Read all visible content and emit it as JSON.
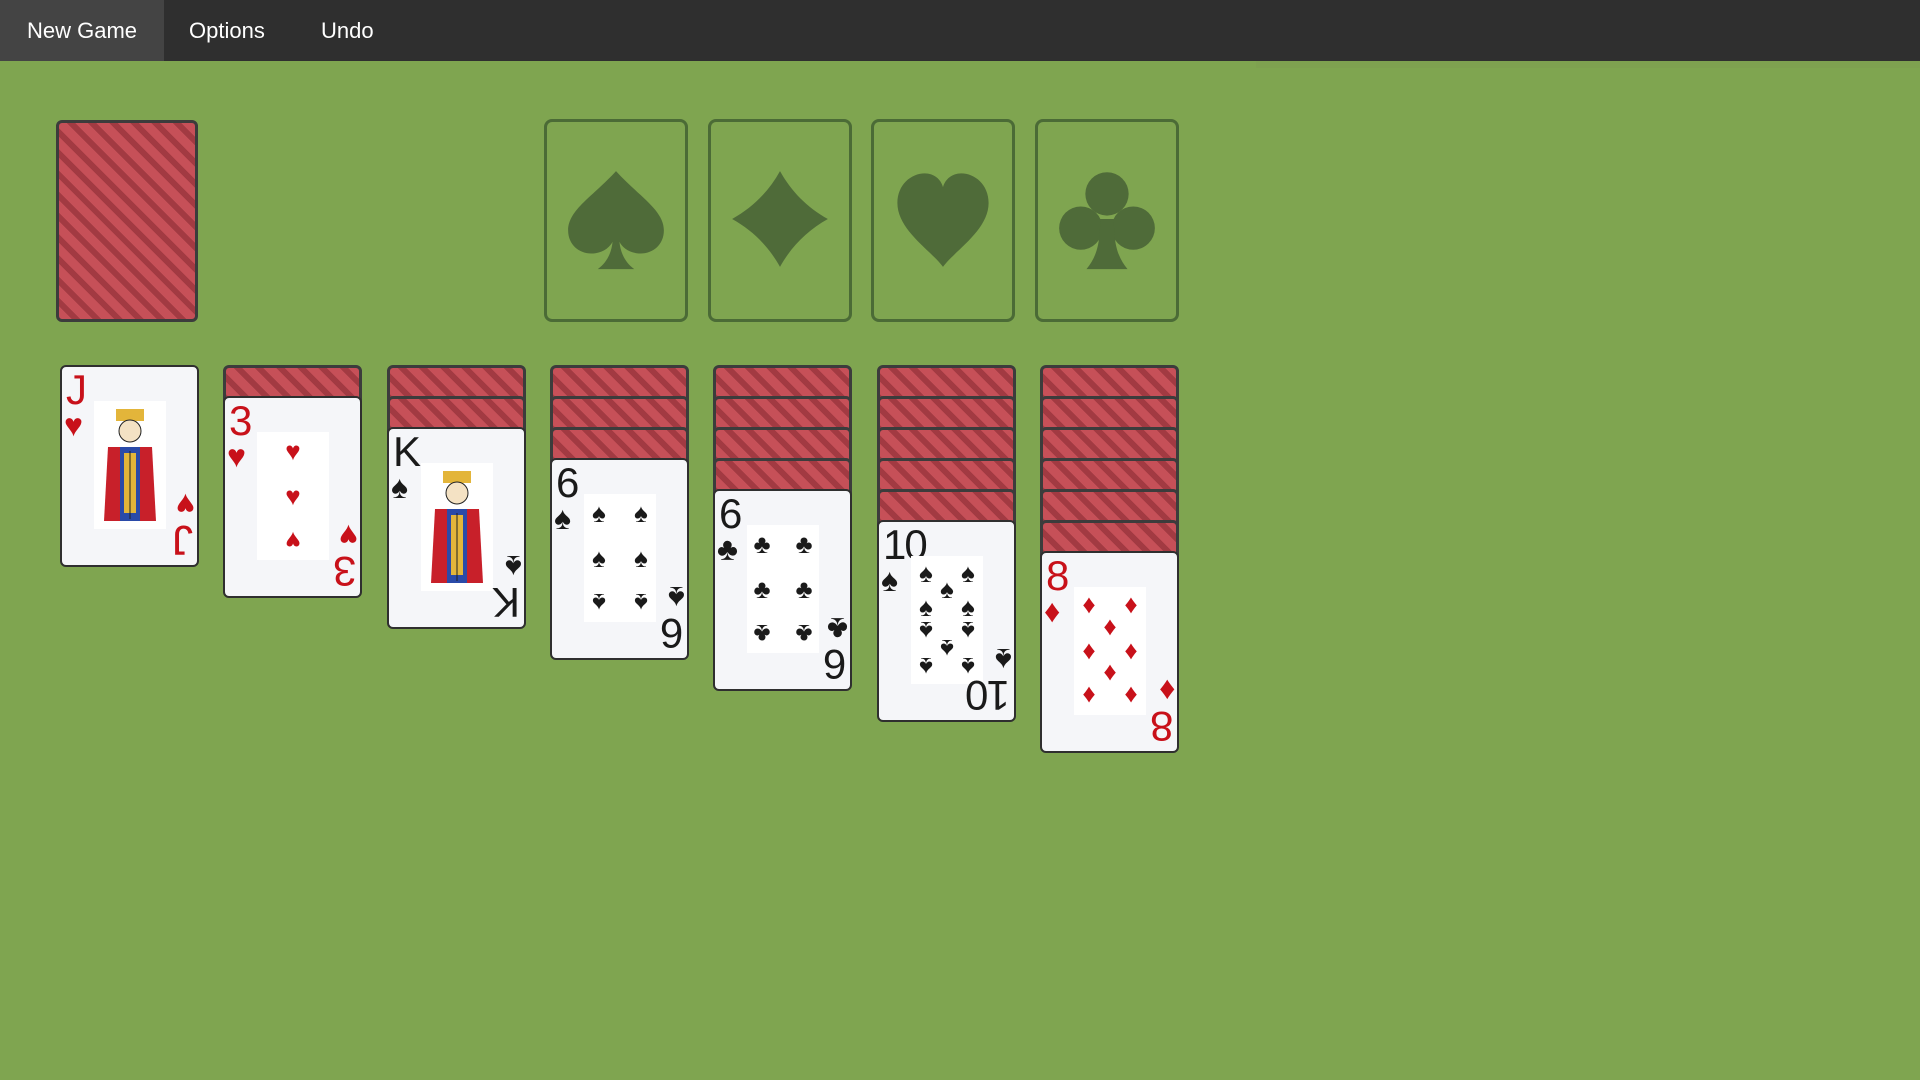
{
  "menu": {
    "new_game": "New Game",
    "options": "Options",
    "undo": "Undo"
  },
  "colors": {
    "felt": "#7fa550",
    "menubar": "#2f2f2f",
    "slot_border": "#4b6b36",
    "card_back_red": "#c65058",
    "red_suit": "#c8111a",
    "black_suit": "#1a1a1a"
  },
  "stock": {
    "face_down": true
  },
  "foundations": [
    {
      "suit": "spades",
      "icon": "spade-icon",
      "cards": 0
    },
    {
      "suit": "diamonds",
      "icon": "diamond-icon",
      "cards": 0
    },
    {
      "suit": "hearts",
      "icon": "heart-icon",
      "cards": 0
    },
    {
      "suit": "clubs",
      "icon": "club-icon",
      "cards": 0
    }
  ],
  "tableau": [
    {
      "hidden": 0,
      "top": {
        "rank": "J",
        "suit": "♥",
        "color": "red"
      }
    },
    {
      "hidden": 1,
      "top": {
        "rank": "3",
        "suit": "♥",
        "color": "red"
      }
    },
    {
      "hidden": 2,
      "top": {
        "rank": "K",
        "suit": "♠",
        "color": "black"
      }
    },
    {
      "hidden": 3,
      "top": {
        "rank": "6",
        "suit": "♠",
        "color": "black"
      }
    },
    {
      "hidden": 4,
      "top": {
        "rank": "6",
        "suit": "♣",
        "color": "black"
      }
    },
    {
      "hidden": 5,
      "top": {
        "rank": "10",
        "suit": "♠",
        "color": "black"
      }
    },
    {
      "hidden": 6,
      "top": {
        "rank": "8",
        "suit": "♦",
        "color": "red"
      }
    }
  ]
}
